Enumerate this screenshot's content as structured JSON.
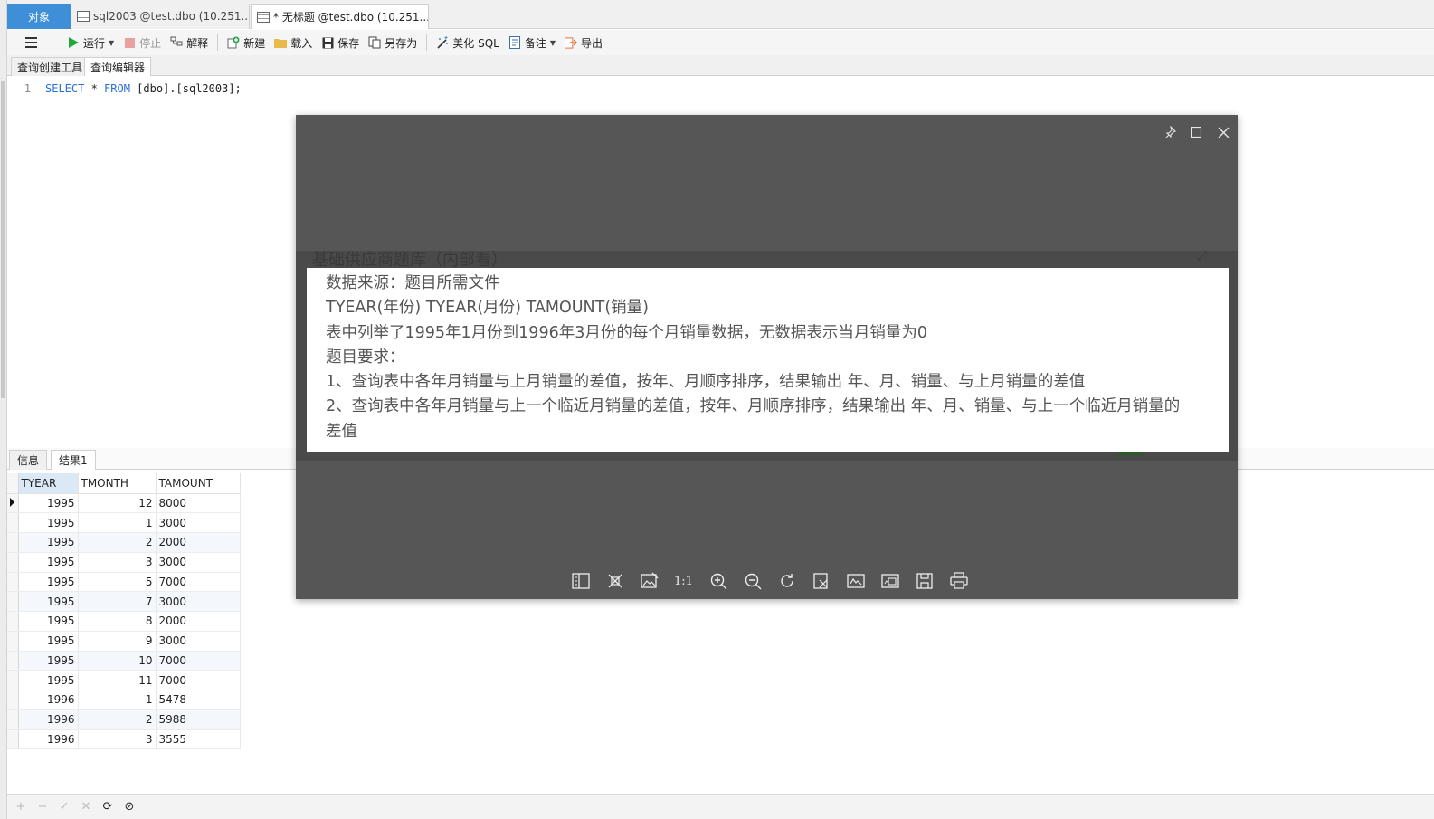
{
  "tabs": {
    "objects": "对象",
    "tab1": "sql2003 @test.dbo (10.251....",
    "tab2": "* 无标题 @test.dbo (10.251...."
  },
  "toolbar": {
    "run": "运行",
    "stop": "停止",
    "explain": "解释",
    "new": "新建",
    "load": "载入",
    "save": "保存",
    "save_as": "另存为",
    "beautify": "美化 SQL",
    "comment": "备注",
    "export": "导出"
  },
  "subtabs": {
    "builder": "查询创建工具",
    "editor": "查询编辑器"
  },
  "editor": {
    "line_number": "1",
    "kw_select": "SELECT",
    "star": " * ",
    "kw_from": "FROM",
    "rest": " [dbo].[sql2003];"
  },
  "result_tabs": {
    "info": "信息",
    "result1": "结果1"
  },
  "grid": {
    "columns": [
      "TYEAR",
      "TMONTH",
      "TAMOUNT"
    ],
    "rows": [
      [
        "1995",
        "12",
        "8000"
      ],
      [
        "1995",
        "1",
        "3000"
      ],
      [
        "1995",
        "2",
        "2000"
      ],
      [
        "1995",
        "3",
        "3000"
      ],
      [
        "1995",
        "5",
        "7000"
      ],
      [
        "1995",
        "7",
        "3000"
      ],
      [
        "1995",
        "8",
        "2000"
      ],
      [
        "1995",
        "9",
        "3000"
      ],
      [
        "1995",
        "10",
        "7000"
      ],
      [
        "1995",
        "11",
        "7000"
      ],
      [
        "1996",
        "1",
        "5478"
      ],
      [
        "1996",
        "2",
        "5988"
      ],
      [
        "1996",
        "3",
        "3555"
      ]
    ]
  },
  "viewer": {
    "ghost_title": "基础供应商题库（内部看）",
    "lines": [
      "数据来源：题目所需文件",
      "TYEAR(年份) TYEAR(月份) TAMOUNT(销量)",
      "表中列举了1995年1月份到1996年3月份的每个月销量数据，无数据表示当月销量为0",
      "题目要求：",
      "1、查询表中各年月销量与上月销量的差值，按年、月顺序排序，结果输出 年、月、销量、与上月销量的差值",
      "2、查询表中各年月销量与上一个临近月销量的差值，按年、月顺序排序，结果输出 年、月、销量、与上一个临近月销量的差值"
    ],
    "ratio_label": "1:1"
  },
  "icons": {
    "pin": "pin-icon",
    "maximize": "maximize-icon",
    "close": "close-icon"
  },
  "colors": {
    "accent": "#3e8ed8",
    "run_green": "#22a83a",
    "keyword": "#2a6fd6",
    "viewer_bg": "#565656"
  }
}
